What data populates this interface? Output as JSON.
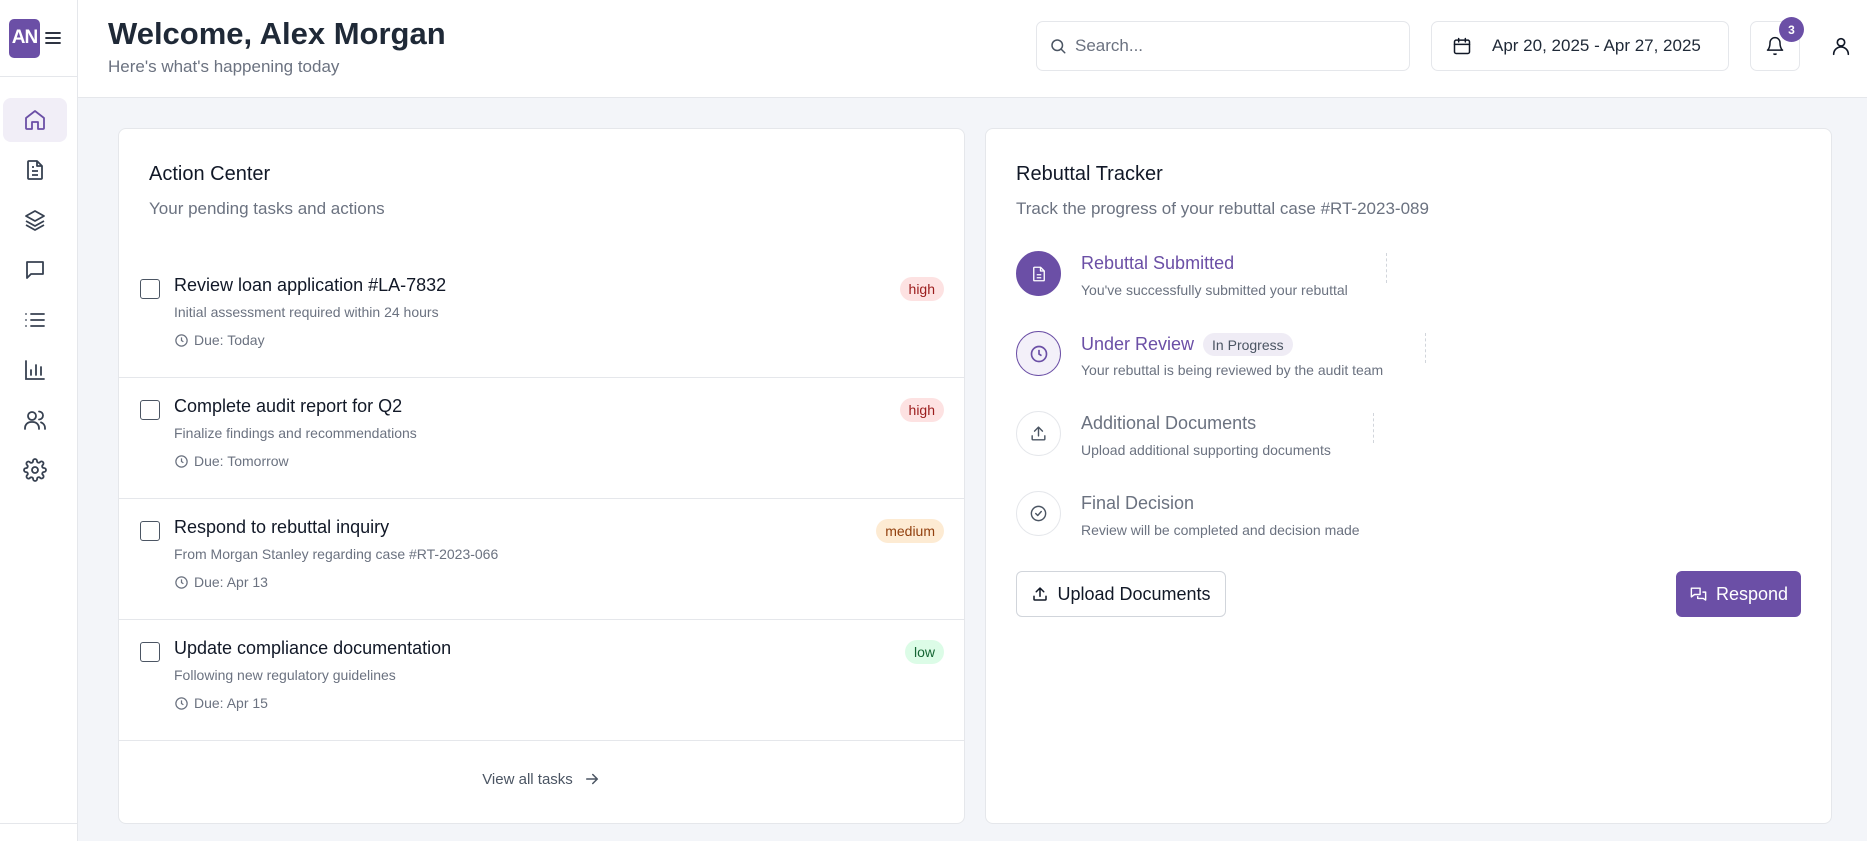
{
  "sidebar": {
    "logo_text": "AN",
    "items": [
      {
        "name": "home",
        "icon": "home-icon",
        "active": true
      },
      {
        "name": "documents",
        "icon": "file-icon",
        "active": false
      },
      {
        "name": "layers",
        "icon": "layers-icon",
        "active": false
      },
      {
        "name": "messages",
        "icon": "message-icon",
        "active": false
      },
      {
        "name": "list",
        "icon": "list-icon",
        "active": false
      },
      {
        "name": "analytics",
        "icon": "bar-chart-icon",
        "active": false
      },
      {
        "name": "users",
        "icon": "users-icon",
        "active": false
      },
      {
        "name": "settings",
        "icon": "gear-icon",
        "active": false
      }
    ]
  },
  "header": {
    "title": "Welcome, Alex Morgan",
    "subtitle": "Here's what's happening today",
    "search_placeholder": "Search...",
    "date_range": "Apr 20, 2025 - Apr 27, 2025",
    "notification_count": "3"
  },
  "action_center": {
    "title": "Action Center",
    "description": "Your pending tasks and actions",
    "tasks": [
      {
        "title": "Review loan application #LA-7832",
        "description": "Initial assessment required within 24 hours",
        "due": "Due: Today",
        "priority": "high"
      },
      {
        "title": "Complete audit report for Q2",
        "description": "Finalize findings and recommendations",
        "due": "Due: Tomorrow",
        "priority": "high"
      },
      {
        "title": "Respond to rebuttal inquiry",
        "description": "From Morgan Stanley regarding case #RT-2023-066",
        "due": "Due: Apr 13",
        "priority": "medium"
      },
      {
        "title": "Update compliance documentation",
        "description": "Following new regulatory guidelines",
        "due": "Due: Apr 15",
        "priority": "low"
      }
    ],
    "view_all_label": "View all tasks"
  },
  "rebuttal_tracker": {
    "title": "Rebuttal Tracker",
    "description": "Track the progress of your rebuttal case #RT-2023-089",
    "steps": [
      {
        "title": "Rebuttal Submitted",
        "description": "You've successfully submitted your rebuttal",
        "state": "done",
        "icon": "document-icon"
      },
      {
        "title": "Under Review",
        "description": "Your rebuttal is being reviewed by the audit team",
        "state": "current",
        "icon": "clock-icon",
        "status": "In Progress"
      },
      {
        "title": "Additional Documents",
        "description": "Upload additional supporting documents",
        "state": "pending",
        "icon": "upload-icon"
      },
      {
        "title": "Final Decision",
        "description": "Review will be completed and decision made",
        "state": "pending",
        "icon": "check-circle-icon"
      }
    ],
    "upload_label": "Upload Documents",
    "respond_label": "Respond"
  },
  "colors": {
    "accent": "#6b4fa6",
    "priority_high_bg": "#fde2e2",
    "priority_medium_bg": "#fdebd3",
    "priority_low_bg": "#dcfce7"
  }
}
